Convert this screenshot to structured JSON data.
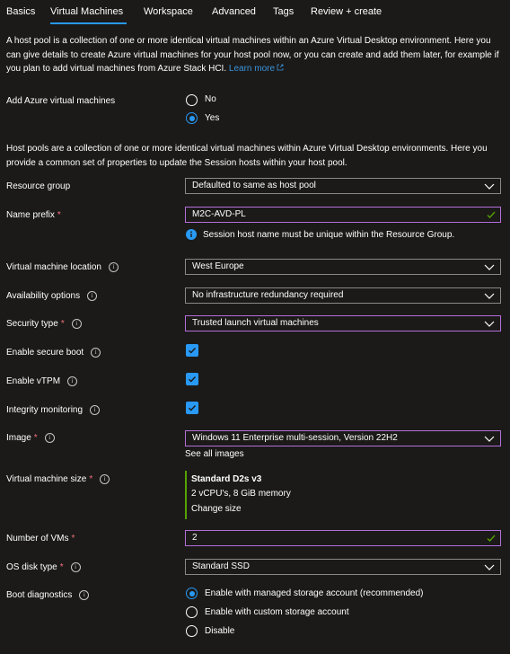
{
  "tabs": [
    {
      "label": "Basics"
    },
    {
      "label": "Virtual Machines"
    },
    {
      "label": "Workspace"
    },
    {
      "label": "Advanced"
    },
    {
      "label": "Tags"
    },
    {
      "label": "Review + create"
    }
  ],
  "intro": {
    "text": "A host pool is a collection of one or more identical virtual machines within an Azure Virtual Desktop environment. Here you can give details to create Azure virtual machines for your host pool now, or you can create and add them later, for example if you plan to add virtual machines from Azure Stack HCI.",
    "link": "Learn more"
  },
  "add_vms": {
    "label": "Add Azure virtual machines",
    "options": [
      "No",
      "Yes"
    ],
    "selected": "Yes"
  },
  "host_pool_desc": "Host pools are a collection of one or more identical virtual machines within Azure Virtual Desktop environments. Here you provide a common set of properties to update the Session hosts within your host pool.",
  "fields": {
    "resource_group": {
      "label": "Resource group",
      "value": "Defaulted to same as host pool"
    },
    "name_prefix": {
      "label": "Name prefix",
      "value": "M2C-AVD-PL",
      "hint": "Session host name must be unique within the Resource Group."
    },
    "vm_location": {
      "label": "Virtual machine location",
      "value": "West Europe"
    },
    "availability": {
      "label": "Availability options",
      "value": "No infrastructure redundancy required"
    },
    "security_type": {
      "label": "Security type",
      "value": "Trusted launch virtual machines"
    },
    "secure_boot": {
      "label": "Enable secure boot",
      "checked": true
    },
    "vtpm": {
      "label": "Enable vTPM",
      "checked": true
    },
    "integrity": {
      "label": "Integrity monitoring",
      "checked": true
    },
    "image": {
      "label": "Image",
      "value": "Windows 11 Enterprise multi-session, Version 22H2",
      "link": "See all images"
    },
    "vm_size": {
      "label": "Virtual machine size",
      "name": "Standard D2s v3",
      "specs": "2 vCPU's, 8 GiB memory",
      "link": "Change size"
    },
    "num_vms": {
      "label": "Number of VMs",
      "value": "2"
    },
    "os_disk": {
      "label": "OS disk type",
      "value": "Standard SSD"
    },
    "boot_diag": {
      "label": "Boot diagnostics",
      "options": [
        "Enable with managed storage account (recommended)",
        "Enable with custom storage account",
        "Disable"
      ],
      "selected": "Enable with managed storage account (recommended)"
    }
  },
  "colors": {
    "accent": "#2899f5",
    "link": "#3a96dd",
    "required": "#f1707b",
    "valid": "#57a300",
    "focus": "#b46ed8",
    "background": "#1b1a19"
  }
}
